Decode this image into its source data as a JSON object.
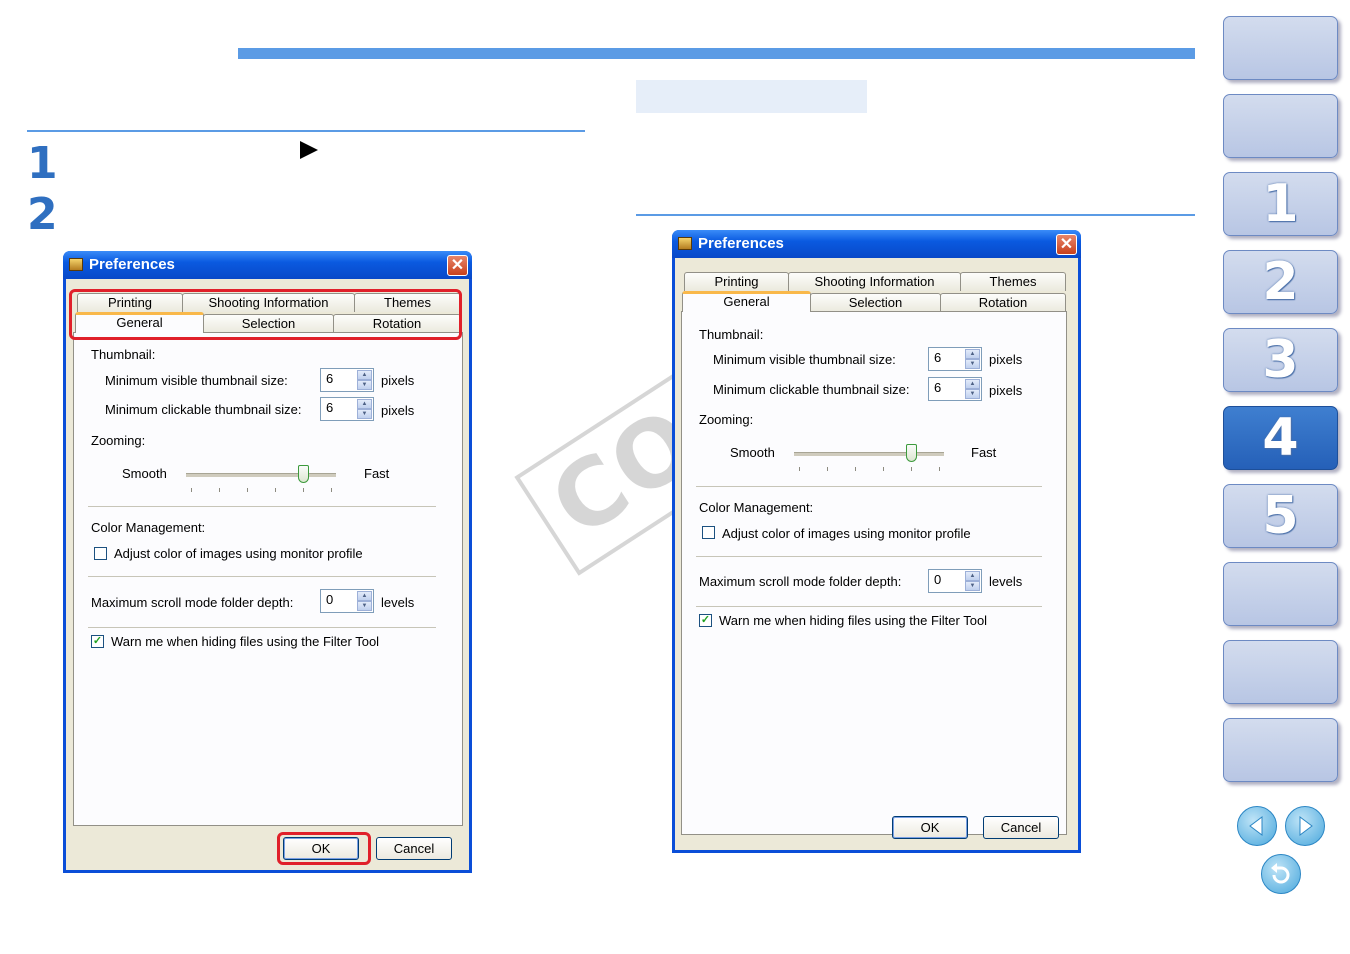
{
  "steps": [
    {
      "number": "1"
    },
    {
      "number": "2"
    }
  ],
  "sidebar": {
    "buttons": [
      {
        "label": ""
      },
      {
        "label": ""
      },
      {
        "label": "1"
      },
      {
        "label": "2"
      },
      {
        "label": "3"
      },
      {
        "label": "4",
        "active": true
      },
      {
        "label": "5"
      },
      {
        "label": ""
      },
      {
        "label": ""
      },
      {
        "label": ""
      }
    ],
    "nav_icons": [
      "prev-page-icon",
      "next-page-icon",
      "back-icon"
    ]
  },
  "watermark": "COPY",
  "dialog": {
    "title": "Preferences",
    "close_glyph": "✕",
    "tabs_row1": [
      "Printing",
      "Shooting Information",
      "Themes"
    ],
    "tabs_row2": [
      "General",
      "Selection",
      "Rotation"
    ],
    "thumbnail_heading": "Thumbnail:",
    "min_visible_label": "Minimum visible thumbnail size:",
    "min_visible_value": "6",
    "min_clickable_label": "Minimum clickable thumbnail size:",
    "min_clickable_value": "6",
    "pixels_unit": "pixels",
    "zooming_heading": "Zooming:",
    "smooth_label": "Smooth",
    "fast_label": "Fast",
    "zoom_level_fraction": 0.78,
    "color_mgmt_heading": "Color Management:",
    "adjust_color_label": "Adjust color of images using monitor profile",
    "adjust_color_checked": false,
    "scroll_depth_label": "Maximum scroll mode folder depth:",
    "scroll_depth_value": "0",
    "levels_unit": "levels",
    "warn_label": "Warn me when hiding files using the Filter Tool",
    "warn_checked": true,
    "ok_label": "OK",
    "cancel_label": "Cancel",
    "check_glyph": "✓"
  },
  "colors": {
    "accent": "#5b9be5",
    "step_number": "#2f6fc0",
    "highlight": "#e0202a"
  }
}
